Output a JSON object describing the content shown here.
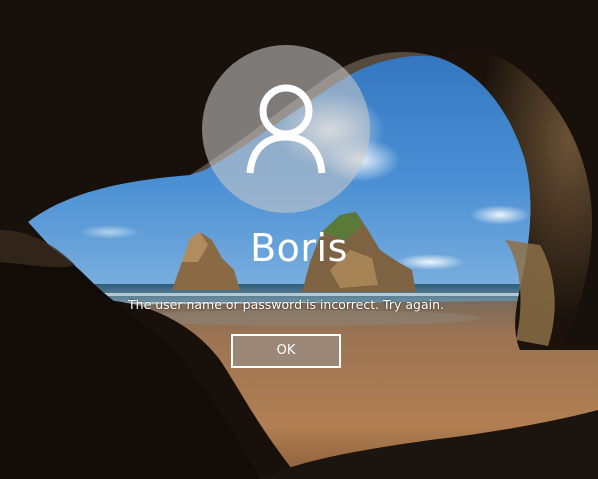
{
  "user": {
    "name": "Boris"
  },
  "error": {
    "message": "The user name or password is incorrect. Try again."
  },
  "buttons": {
    "ok_label": "OK"
  },
  "icons": {
    "avatar": "user-silhouette-icon"
  },
  "colors": {
    "text": "#ffffff",
    "sky": "#3d7fc6",
    "sand": "#b07a4e",
    "cave": "#1a120c"
  }
}
